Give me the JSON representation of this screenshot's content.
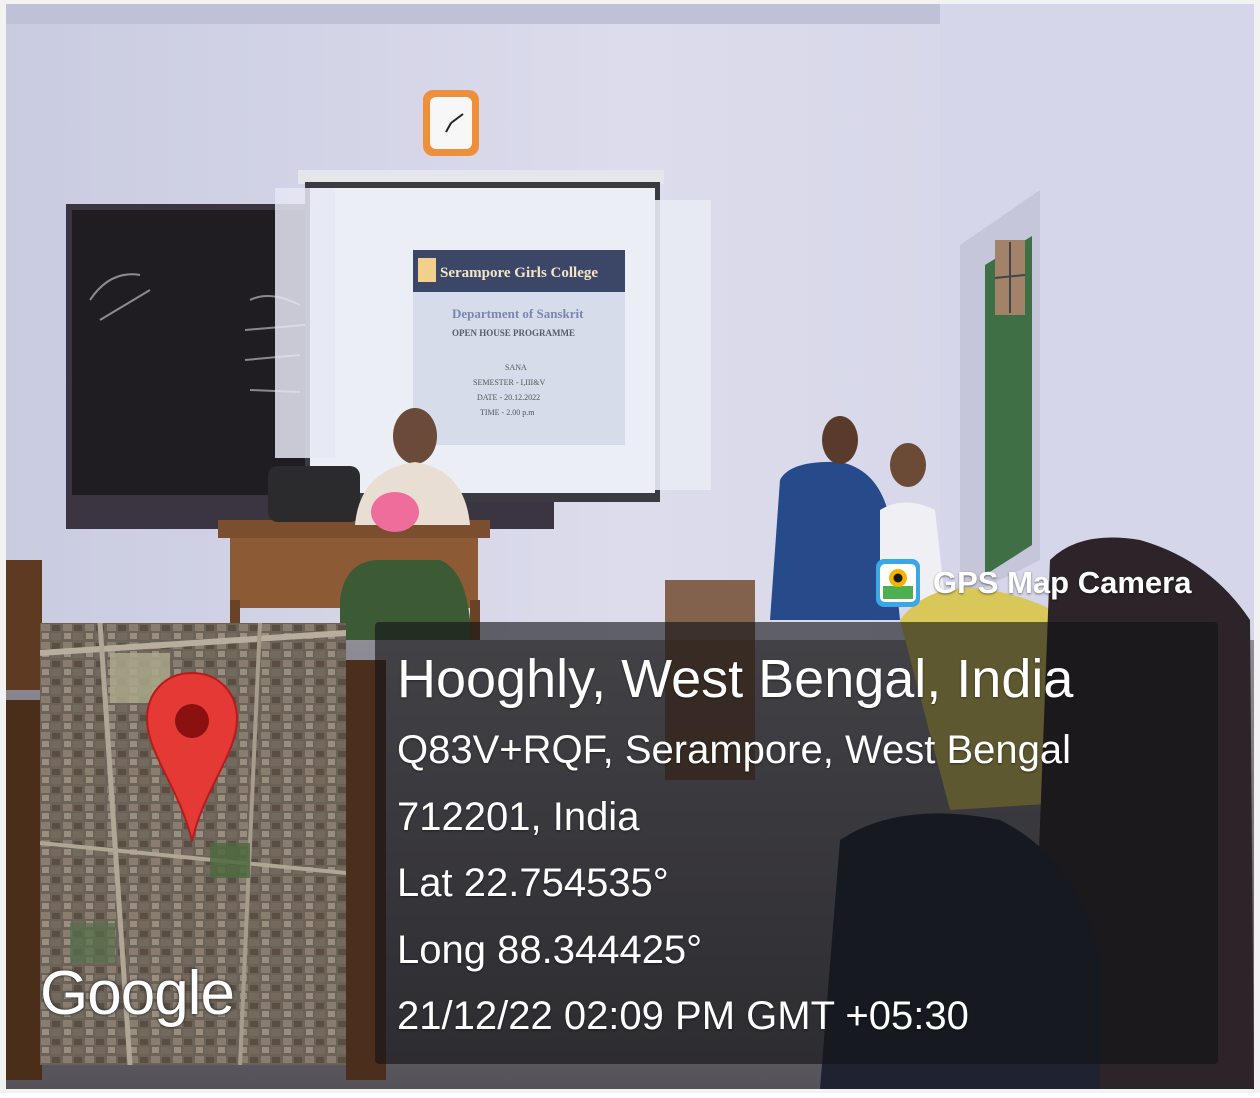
{
  "stamp": {
    "app_name": "GPS Map Camera",
    "app_icon": "gps-camera-icon",
    "location_title": "Hooghly, West Bengal, India",
    "address_line1": "Q83V+RQF, Serampore, West Bengal",
    "address_line2": "712201, India",
    "latitude": "Lat 22.754535°",
    "longitude": "Long 88.344425°",
    "datetime": "21/12/22 02:09 PM GMT +05:30"
  },
  "map": {
    "attribution": "Google",
    "pin_icon": "map-pin-icon",
    "pin_color": "#e53935"
  },
  "slide": {
    "college": "Serampore Girls College",
    "department": "Department of Sanskrit",
    "programme": "OPEN HOUSE PROGRAMME",
    "name": "SANA",
    "semester": "SEMESTER - I,III&V",
    "date": "DATE - 20.12.2022",
    "time": "TIME - 2.00 p.m"
  }
}
